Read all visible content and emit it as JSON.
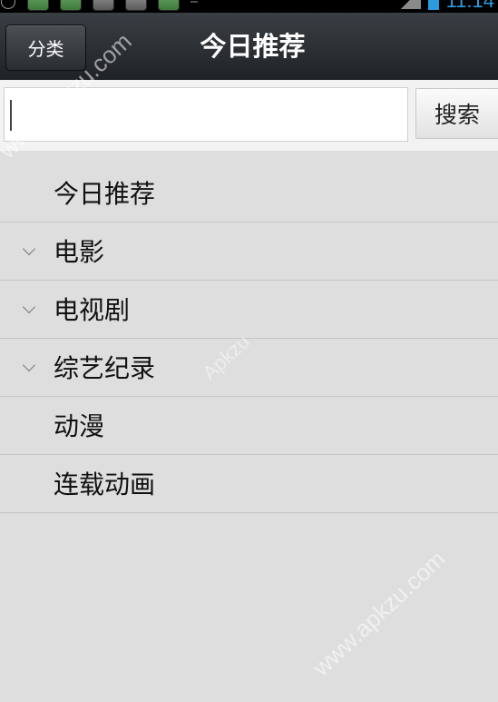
{
  "status_bar": {
    "time": "11:14"
  },
  "header": {
    "category_button_label": "分类",
    "title": "今日推荐"
  },
  "search": {
    "value": "",
    "placeholder": "",
    "button_label": "搜索"
  },
  "categories": [
    {
      "label": "今日推荐",
      "expandable": false
    },
    {
      "label": "电影",
      "expandable": true,
      "icon": "chevron-down-icon"
    },
    {
      "label": "电视剧",
      "expandable": true,
      "icon": "chevron-down-icon"
    },
    {
      "label": "综艺纪录",
      "expandable": true,
      "icon": "chevron-down-icon"
    },
    {
      "label": "动漫",
      "expandable": false
    },
    {
      "label": "连载动画",
      "expandable": false
    }
  ],
  "watermarks": {
    "top": "www.apkzu.com",
    "middle": "Apkzu",
    "bottom": "www.apkzu.com"
  },
  "colors": {
    "action_bar": "#2a2e32",
    "list_background": "#dedede",
    "time_accent": "#2d9be0"
  }
}
